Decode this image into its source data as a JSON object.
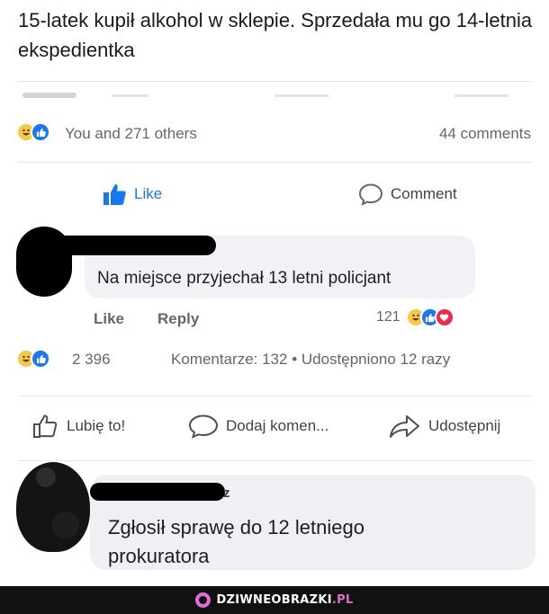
{
  "post": {
    "headline": "15-latek kupił alkohol w sklepie. Sprzedała mu go 14-letnia ekspedientka"
  },
  "top_bar": {
    "reactions_text": "You and 271 others",
    "comments_text": "44 comments",
    "like_label": "Like",
    "comment_label": "Comment"
  },
  "comment1": {
    "text": "Na miejsce przyjechał 13 letni policjant",
    "like_label": "Like",
    "reply_label": "Reply",
    "reaction_count": "121"
  },
  "bottom_bar": {
    "reaction_count": "2 396",
    "stats_text": "Komentarze: 132 • Udostępniono 12 razy",
    "like_label": "Lubię to!",
    "comment_label": "Dodaj komen...",
    "share_label": "Udostępnij"
  },
  "comment2": {
    "name_tail": "z",
    "text_line1": "Zgłosił sprawę do 12 letniego",
    "text_line2": "prokuratora"
  },
  "watermark": {
    "part1": "DZIWNEOBRAZKI",
    "part2": ".PL"
  },
  "colors": {
    "facebook_blue": "#1877f2",
    "haha_yellow": "#f7c94b",
    "love_red": "#f02849",
    "watermark_pink": "#e36bd4"
  }
}
